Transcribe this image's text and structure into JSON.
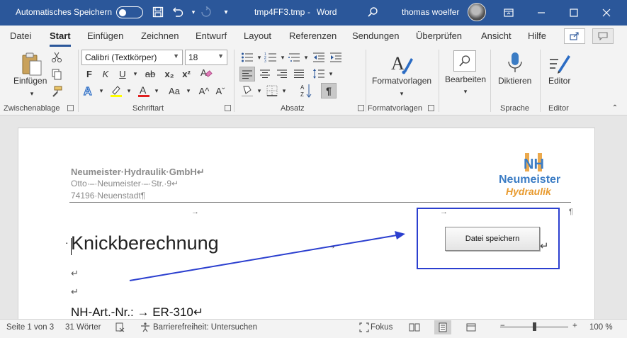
{
  "titlebar": {
    "autosave_label": "Automatisches Speichern",
    "filename": "tmp4FF3.tmp",
    "separator": "-",
    "app_name": "Word",
    "user_name": "thomas woelfer",
    "icons": [
      "save-icon",
      "undo-icon",
      "redo-icon",
      "customize-icon",
      "search-icon",
      "ribbon-display-icon",
      "minimize-icon",
      "maximize-icon",
      "close-icon"
    ]
  },
  "menu": {
    "tabs": [
      "Datei",
      "Start",
      "Einfügen",
      "Zeichnen",
      "Entwurf",
      "Layout",
      "Referenzen",
      "Sendungen",
      "Überprüfen",
      "Ansicht",
      "Hilfe"
    ],
    "active": "Start"
  },
  "ribbon": {
    "clipboard": {
      "paste_label": "Einfügen",
      "group_label": "Zwischenablage"
    },
    "font": {
      "family": "Calibri (Textkörper)",
      "size": "18",
      "group_label": "Schriftart",
      "btn_bold": "F",
      "btn_italic": "K",
      "btn_underline": "U",
      "btn_strike": "ab",
      "btn_sub": "x₂",
      "btn_sup": "x²",
      "btn_case": "Aa",
      "btn_grow": "A^",
      "btn_shrink": "Aˇ"
    },
    "paragraph": {
      "group_label": "Absatz"
    },
    "styles": {
      "label": "Formatvorlagen",
      "group_label": "Formatvorlagen"
    },
    "editing": {
      "label": "Bearbeiten"
    },
    "voice": {
      "label": "Diktieren",
      "group_label": "Sprache"
    },
    "editor": {
      "label": "Editor",
      "group_label": "Editor"
    }
  },
  "document": {
    "company": "Neumeister·Hydraulik·GmbH↵",
    "address1": "Otto·–·Neumeister·–·Str.·9↵",
    "address2": "74196·Neuenstadt¶",
    "heading": "Knickberechnung",
    "nh_line": "NH-Art.-Nr.: → ER-310↵",
    "save_button": "Datei speichern",
    "logo_line1": "Neumeister",
    "logo_line2": "Hydraulik",
    "logo_mark": "NH"
  },
  "statusbar": {
    "page": "Seite 1 von 3",
    "words": "31 Wörter",
    "accessibility": "Barrierefreiheit: Untersuchen",
    "focus": "Fokus",
    "zoom_minus": "−",
    "zoom_plus": "+",
    "zoom": "100 %"
  },
  "colors": {
    "titlebar_bg": "#2b579a",
    "callout_border": "#2b3fcf",
    "logo_blue": "#3b7cc4",
    "logo_orange": "#e89a2e"
  }
}
